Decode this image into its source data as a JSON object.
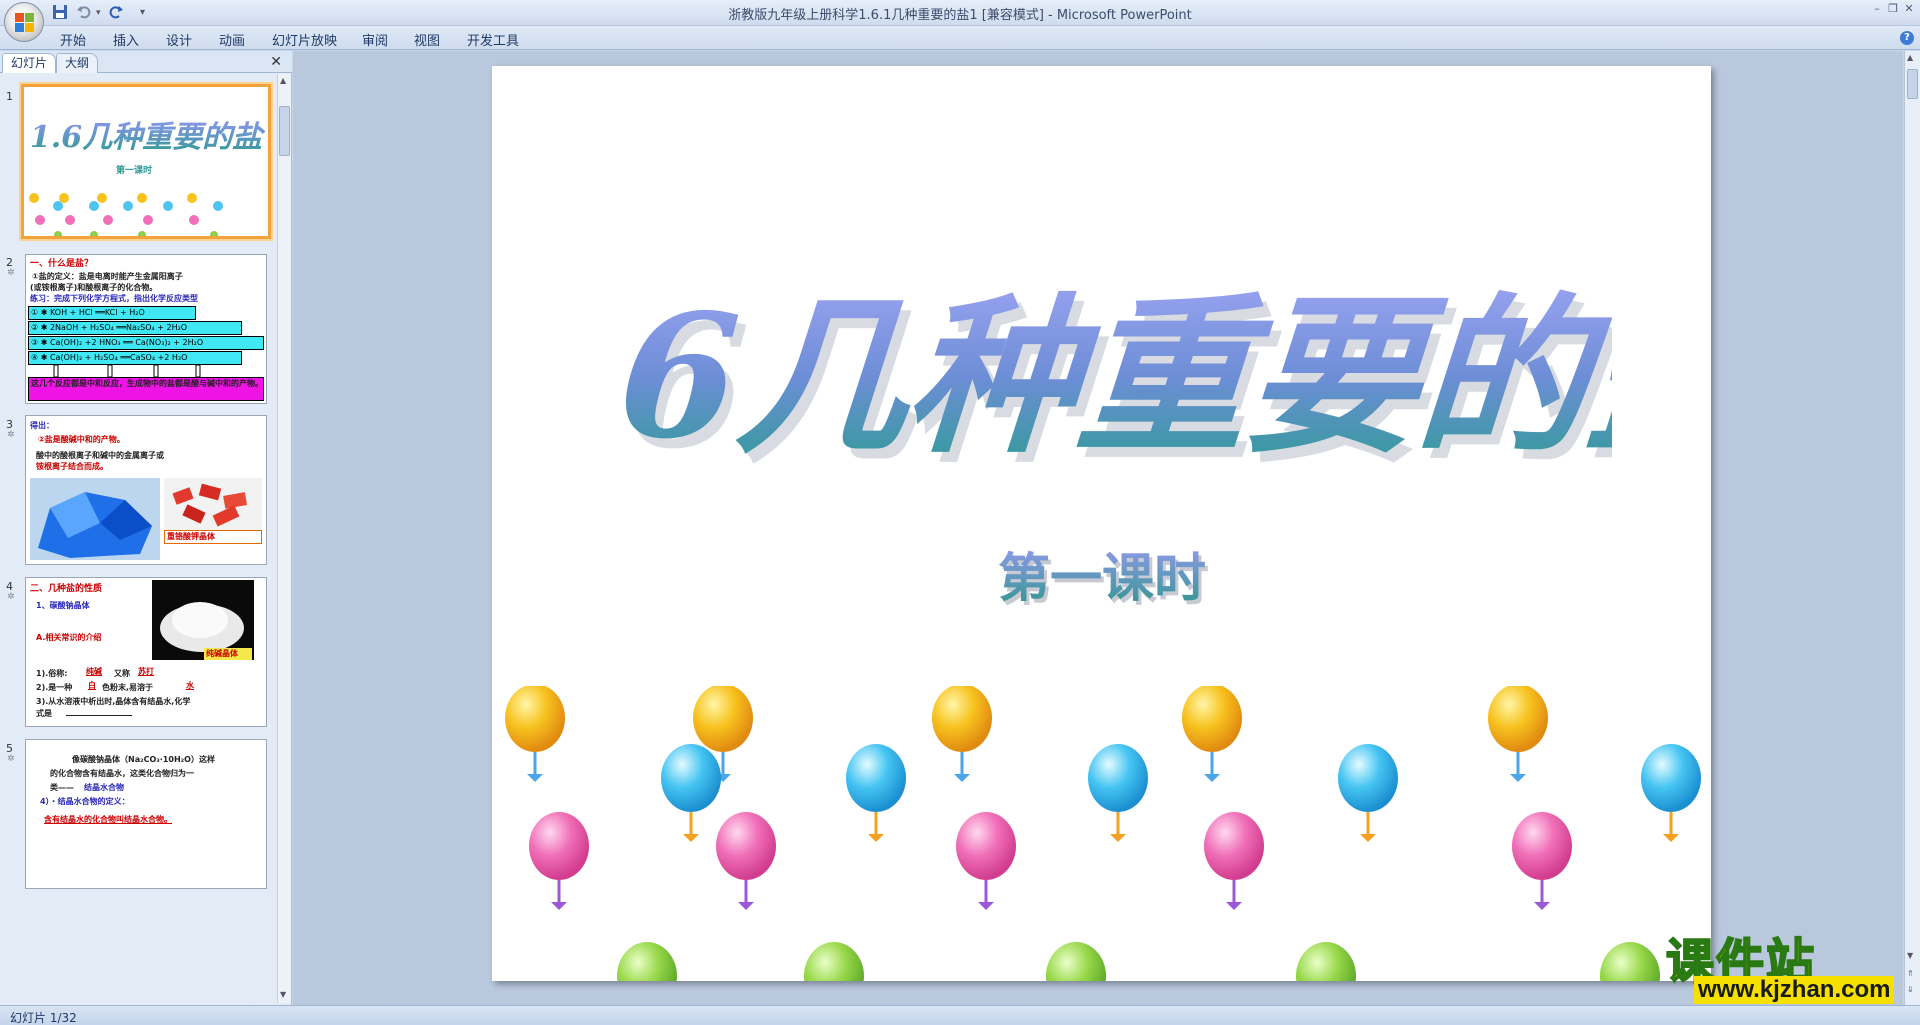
{
  "window": {
    "title": "浙教版九年级上册科学1.6.1几种重要的盐1 [兼容模式] - Microsoft PowerPoint"
  },
  "quick_access": {
    "save_icon": "save-icon",
    "undo_icon": "undo-icon",
    "redo_icon": "redo-icon",
    "customize": "▾"
  },
  "window_controls": {
    "minimize": "–",
    "restore": "❐",
    "close": "✕"
  },
  "ribbon": {
    "tabs": [
      "开始",
      "插入",
      "设计",
      "动画",
      "幻灯片放映",
      "审阅",
      "视图",
      "开发工具"
    ]
  },
  "left_panel": {
    "tabs": [
      "幻灯片",
      "大纲"
    ],
    "close": "✕",
    "slides": [
      {
        "num": "1",
        "title": "1.6几种重要的盐",
        "subtitle": "第一课时"
      },
      {
        "num": "2",
        "lines": [
          "一、什么是盐？",
          "①盐的定义：盐是电离时能产生金属阳离子",
          "(或铵根离子)和酸根离子的化合物。",
          "练习：完成下列化学方程式，指出化学反应类型"
        ],
        "boxes": [
          "① ✱ KOH + HCl ══KCl + H₂O",
          "② ✱ 2NaOH + H₂SO₄ ══Na₂SO₄ + 2H₂O",
          "③ ✱ Ca(OH)₂ +2 HNO₃ ══ Ca(NO₃)₂ + 2H₂O",
          "④ ✱ Ca(OH)₂ + H₂SO₄ ══CaSO₄ +2 H₂O"
        ],
        "note": "这几个反应都是中和反应，生成物中的盐都是酸与碱中和的产物。"
      },
      {
        "num": "3",
        "lines": [
          "得出：",
          "②盐是酸碱中和的产物。",
          "酸中的酸根离子和碱中的金属离子或",
          "铵根离子结合而成。"
        ],
        "caption": "重铬酸钾晶体"
      },
      {
        "num": "4",
        "lines": [
          "二、几种盐的性质",
          "1、碳酸钠晶体",
          "A.相关常识的介绍",
          "1).俗称:",
          "纯碱",
          "又称",
          "苏打",
          "2).是一种",
          "白",
          "色粉末,易溶于",
          "水",
          "3).从水溶液中析出时,晶体含有结晶水,化学",
          "式是"
        ],
        "caption": "纯碱晶体"
      },
      {
        "num": "5",
        "lines": [
          "像碳酸钠晶体（Na₂CO₃·10H₂O）这样",
          "的化合物含有结晶水，这类化合物归为一",
          "类——",
          "结晶水合物",
          "4）・结晶水合物的定义：",
          "含有结晶水的化合物叫结晶水合物。"
        ]
      }
    ]
  },
  "slide": {
    "title": "1.6几种重要的盐",
    "subtitle": "第一课时"
  },
  "status_bar": {
    "text": "幻灯片 1/32"
  },
  "watermark": {
    "brand": "课件站",
    "url": "www.kjzhan.com"
  },
  "colors": {
    "title_top": "#8b96ea",
    "title_bottom": "#2e9a94",
    "selected_border": "#f3a33a"
  }
}
